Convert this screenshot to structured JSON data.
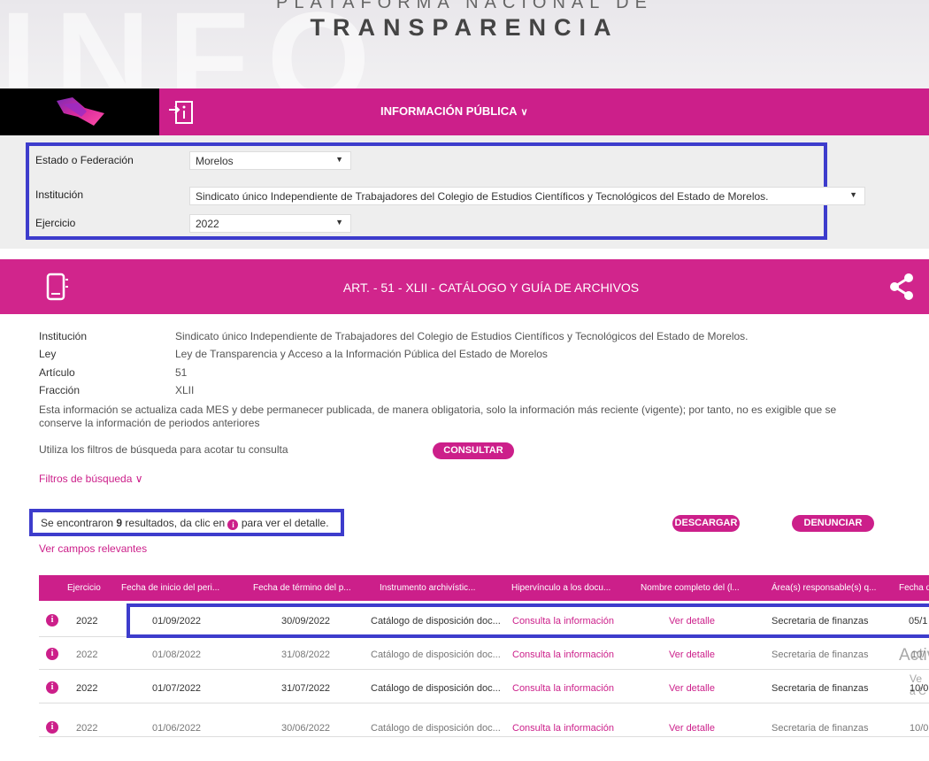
{
  "hero": {
    "bg_text": "INFO",
    "subtitle": "PLATAFORMA NACIONAL DE",
    "title": "TRANSPARENCIA"
  },
  "nav": {
    "menu_label": "INFORMACIÓN PÚBLICA",
    "menu_chevron": "∨"
  },
  "filters": {
    "estado_label": "Estado o Federación",
    "estado_value": "Morelos",
    "institucion_label": "Institución",
    "institucion_value": "Sindicato único Independiente de Trabajadores del Colegio de Estudios Científicos y Tecnológicos del Estado de Morelos.",
    "ejercicio_label": "Ejercicio",
    "ejercicio_value": "2022",
    "arrow": "▼"
  },
  "section": {
    "title": "ART. - 51 - XLII - CATÁLOGO Y GUÍA DE ARCHIVOS"
  },
  "details": {
    "institucion_key": "Institución",
    "institucion_val": "Sindicato único Independiente de Trabajadores del Colegio de Estudios Científicos y Tecnológicos del Estado de Morelos.",
    "ley_key": "Ley",
    "ley_val": "Ley de Transparencia y Acceso a la Información Pública del Estado de Morelos",
    "articulo_key": "Artículo",
    "articulo_val": "51",
    "fraccion_key": "Fracción",
    "fraccion_val": "XLII",
    "notice": "Esta información se actualiza cada MES y debe permanecer publicada, de manera obligatoria, solo la información más reciente (vigente); por tanto, no es exigible que se conserve la información de periodos anteriores"
  },
  "search": {
    "hint": "Utiliza los filtros de búsqueda para acotar tu consulta",
    "consultar": "CONSULTAR",
    "filtros_link": "Filtros de búsqueda",
    "filtros_chevron": "∨"
  },
  "results": {
    "prefix": "Se encontraron ",
    "count": "9",
    "middle": " resultados, da clic en ",
    "suffix": " para ver el detalle.",
    "info_glyph": "i",
    "descargar": "DESCARGAR",
    "denunciar": "DENUNCIAR",
    "ver_campos": "Ver campos relevantes"
  },
  "table": {
    "headers": [
      "Ejercicio",
      "Fecha de inicio del peri...",
      "Fecha de término del p...",
      "Instrumento archivístic...",
      "Hipervínculo a los docu...",
      "Nombre completo del (l...",
      "Área(s) responsable(s) q...",
      "Fecha d"
    ],
    "rows": [
      {
        "ejercicio": "2022",
        "inicio": "01/09/2022",
        "termino": "30/09/2022",
        "instrumento": "Catálogo de disposición doc...",
        "hipervinculo": "Consulta la información",
        "nombre": "Ver detalle",
        "area": "Secretaria de finanzas",
        "fecha": "05/1"
      },
      {
        "ejercicio": "2022",
        "inicio": "01/08/2022",
        "termino": "31/08/2022",
        "instrumento": "Catálogo de disposición doc...",
        "hipervinculo": "Consulta la información",
        "nombre": "Ver detalle",
        "area": "Secretaria de finanzas",
        "fecha": "10/"
      },
      {
        "ejercicio": "2022",
        "inicio": "01/07/2022",
        "termino": "31/07/2022",
        "instrumento": "Catálogo de disposición doc...",
        "hipervinculo": "Consulta la información",
        "nombre": "Ver detalle",
        "area": "Secretaria de finanzas",
        "fecha": "10/0"
      },
      {
        "ejercicio": "2022",
        "inicio": "01/06/2022",
        "termino": "30/06/2022",
        "instrumento": "Catálogo de disposición doc...",
        "hipervinculo": "Consulta la información",
        "nombre": "Ver detalle",
        "area": "Secretaria de finanzas",
        "fecha": "10/0"
      }
    ],
    "info_glyph": "i"
  },
  "watermark": {
    "line1": "Activ",
    "line2": "Ve a C"
  }
}
